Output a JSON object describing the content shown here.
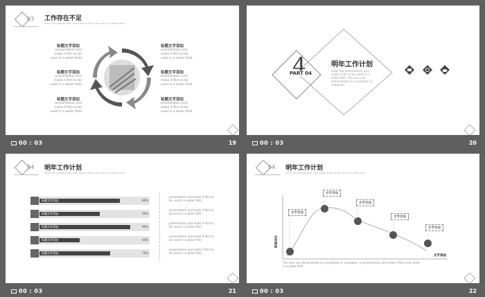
{
  "slides": [
    {
      "section_num": "03",
      "title": "工作存在不足",
      "subtitle": "enter the presentation and make it film to be used in a wider field",
      "items": [
        {
          "title": "标题文字添加",
          "desc": "presentation and make it film to be used in a wider field"
        },
        {
          "title": "标题文字添加",
          "desc": "presentation and make it film to be used in a wider field"
        },
        {
          "title": "标题文字添加",
          "desc": "presentation and make it film to be used in a wider field"
        },
        {
          "title": "标题文字添加",
          "desc": "presentation and make it film to be used in a wider field"
        },
        {
          "title": "标题文字添加",
          "desc": "presentation and make it film to be used in a wider field"
        },
        {
          "title": "标题文字添加",
          "desc": "presentation and make it film to be used in a wider field"
        }
      ],
      "time": "00 : 03",
      "page": "19"
    },
    {
      "big_num": "4",
      "part": "PART 04",
      "title": "明年工作计划",
      "desc": "enter the presentation and make it film to be used in a wider field. The user can demonstrate on a projector or computer",
      "icons": [
        "chat-icon",
        "refresh-icon",
        "cloud-icon"
      ],
      "time": "00 : 03",
      "page": "20"
    },
    {
      "section_num": "04",
      "title": "明年工作计划",
      "subtitle": "enter the presentation and make it film to be used in a wider field",
      "rows": [
        {
          "label": "标题文字添加",
          "pct": "80%",
          "value": 0.8,
          "desc": "presentation and make it film to be used in a wider field"
        },
        {
          "label": "标题文字添加",
          "pct": "60%",
          "value": 0.6,
          "desc": "presentation and make it film to be used in a wider field"
        },
        {
          "label": "标题文字添加",
          "pct": "90%",
          "value": 0.9,
          "desc": "presentation and make it film to be used in a wider field"
        },
        {
          "label": "标题文字添加",
          "pct": "40%",
          "value": 0.4,
          "desc": "presentation and make it film to be used in a wider field"
        },
        {
          "label": "标题文字添加",
          "pct": "70%",
          "value": 0.7,
          "desc": "presentation and make it film to be used in a wider field"
        }
      ],
      "time": "00 : 03",
      "page": "21"
    },
    {
      "section_num": "04",
      "title": "明年工作计划",
      "subtitle": "enter the presentation and make it film to be used in a wider field",
      "callouts": [
        "文字添加",
        "文字添加",
        "文字添加",
        "文字添加",
        "文字添加"
      ],
      "ylabel": "文字添加",
      "xlabel": "文字添加",
      "note": "The user can demonstrate on a projector or computer, or presentation and make it film to be used in a wider field",
      "time": "00 : 03",
      "page": "22"
    }
  ],
  "colors": {
    "bg": "#5f5f5f",
    "dark": "#444444",
    "light": "#e3e3e3"
  }
}
